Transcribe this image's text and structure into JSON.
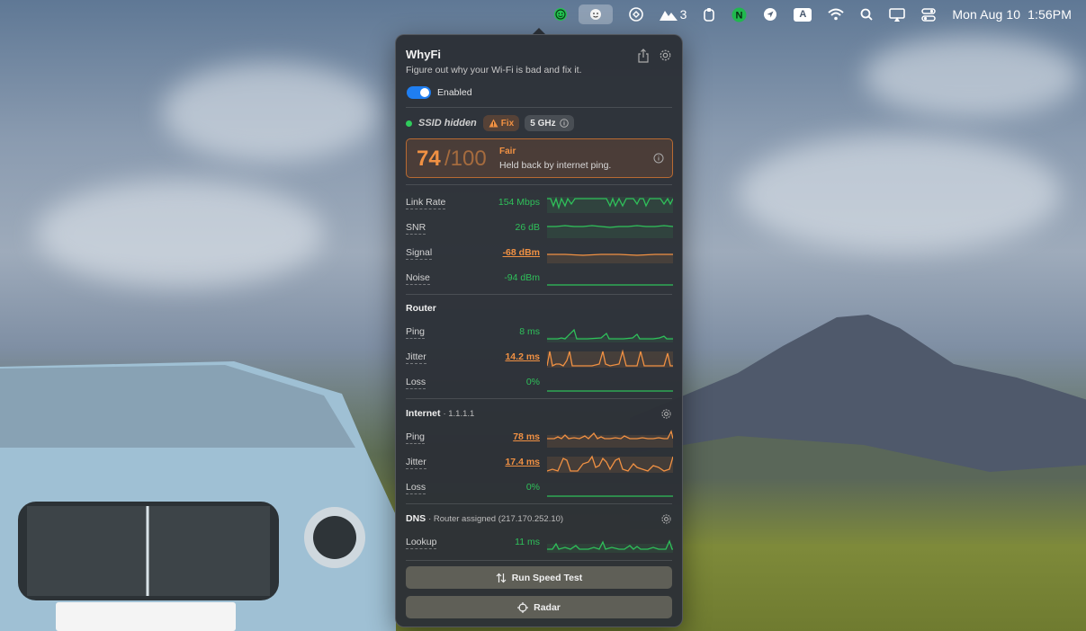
{
  "menubar": {
    "icons": [
      "whyfi-icon",
      "finder-face-icon",
      "chatgpt-icon",
      "mountains-icon",
      "copy-icon",
      "n-app-icon",
      "location-icon",
      "input-source-icon",
      "wifi-icon",
      "search-icon",
      "screen-mirroring-icon",
      "control-center-icon"
    ],
    "badge_count": "3",
    "input_source_label": "A",
    "n_app_label": "N",
    "date": "Mon Aug 10",
    "time": "1:56PM"
  },
  "app": {
    "title": "WhyFi",
    "subtitle": "Figure out why your Wi-Fi is bad and fix it.",
    "toggle_label": "Enabled",
    "toggle_on": true
  },
  "status": {
    "ssid": "SSID hidden",
    "fix_label": "Fix",
    "band_label": "5 GHz"
  },
  "score": {
    "value": "74",
    "max": "/100",
    "grade": "Fair",
    "note": "Held back by internet ping."
  },
  "wifi_metrics": [
    {
      "label": "Link Rate",
      "value": "154 Mbps",
      "state": "good"
    },
    {
      "label": "SNR",
      "value": "26 dB",
      "state": "good"
    },
    {
      "label": "Signal",
      "value": "-68 dBm",
      "state": "warn"
    },
    {
      "label": "Noise",
      "value": "-94 dBm",
      "state": "good"
    }
  ],
  "router": {
    "title": "Router",
    "metrics": [
      {
        "label": "Ping",
        "value": "8 ms",
        "state": "good"
      },
      {
        "label": "Jitter",
        "value": "14.2 ms",
        "state": "warn"
      },
      {
        "label": "Loss",
        "value": "0%",
        "state": "good"
      }
    ]
  },
  "internet": {
    "title": "Internet",
    "target": "· 1.1.1.1",
    "metrics": [
      {
        "label": "Ping",
        "value": "78 ms",
        "state": "warn"
      },
      {
        "label": "Jitter",
        "value": "17.4 ms",
        "state": "warn"
      },
      {
        "label": "Loss",
        "value": "0%",
        "state": "good"
      }
    ]
  },
  "dns": {
    "title": "DNS",
    "source": "· Router assigned (217.170.252.10)",
    "metrics": [
      {
        "label": "Lookup",
        "value": "11 ms",
        "state": "good"
      }
    ]
  },
  "actions": {
    "speed_test": "Run Speed Test",
    "radar": "Radar"
  },
  "colors": {
    "good": "#2fc05a",
    "warn": "#f19143",
    "accent": "#1f7ef1"
  }
}
